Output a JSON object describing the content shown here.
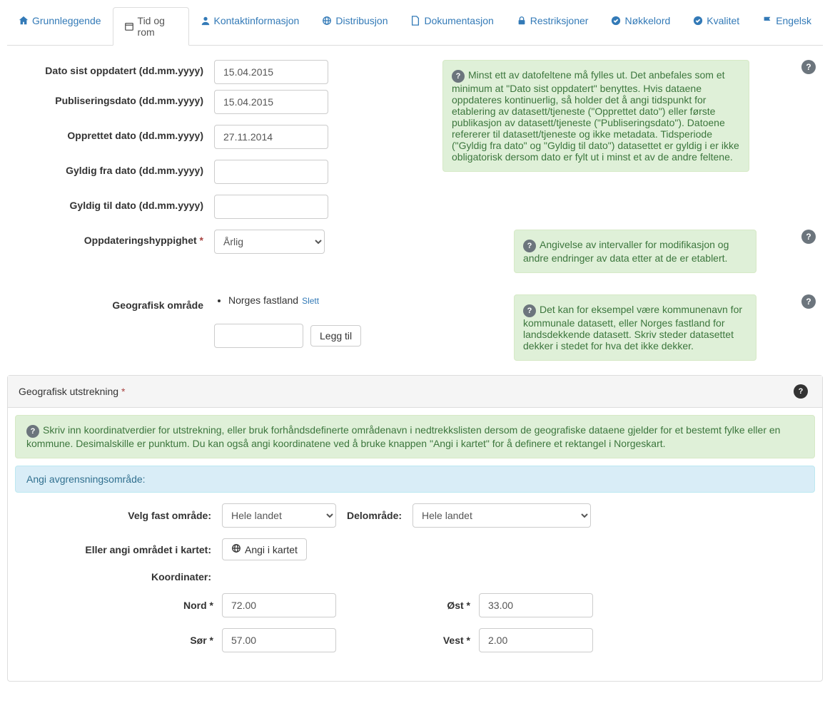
{
  "tabs": {
    "grunnleggende": "Grunnleggende",
    "tid_og_rom": "Tid og rom",
    "kontaktinformasjon": "Kontaktinformasjon",
    "distribusjon": "Distribusjon",
    "dokumentasjon": "Dokumentasjon",
    "restriksjoner": "Restriksjoner",
    "nokkelord": "Nøkkelord",
    "kvalitet": "Kvalitet",
    "engelsk": "Engelsk"
  },
  "labels": {
    "dato_sist_oppdatert": "Dato sist oppdatert (dd.mm.yyyy)",
    "publiseringsdato": "Publiseringsdato (dd.mm.yyyy)",
    "opprettet_dato": "Opprettet dato (dd.mm.yyyy)",
    "gyldig_fra": "Gyldig fra dato (dd.mm.yyyy)",
    "gyldig_til": "Gyldig til dato (dd.mm.yyyy)",
    "oppdateringshyppighet": "Oppdateringshyppighet",
    "geografisk_omrade": "Geografisk område",
    "legg_til": "Legg til",
    "slett": "Slett",
    "velg_fast_omrade": "Velg fast område:",
    "delomrade": "Delområde:",
    "eller_angi": "Eller angi området i kartet:",
    "angi_i_kartet": "Angi i kartet",
    "koordinater": "Koordinater:",
    "nord": "Nord",
    "sor": "Sør",
    "ost": "Øst",
    "vest": "Vest",
    "angi_avgrensning": "Angi avgrensningsområde:"
  },
  "values": {
    "dato_sist_oppdatert": "15.04.2015",
    "publiseringsdato": "15.04.2015",
    "opprettet_dato": "27.11.2014",
    "gyldig_fra": "",
    "gyldig_til": "",
    "oppdateringshyppighet": "Årlig",
    "geo_area_input": "",
    "velg_fast_omrade": "Hele landet",
    "delomrade": "Hele landet",
    "nord": "72.00",
    "sor": "57.00",
    "ost": "33.00",
    "vest": "2.00"
  },
  "geo_areas": [
    "Norges fastland"
  ],
  "help": {
    "dates": "Minst ett av datofeltene må fylles ut. Det anbefales som et minimum at \"Dato sist oppdatert\" benyttes. Hvis dataene oppdateres kontinuerlig, så holder det å angi tidspunkt for etablering av datasett/tjeneste (\"Opprettet dato\") eller første publikasjon av datasett/tjeneste (\"Publiseringsdato\"). Datoene refererer til datasett/tjeneste og ikke metadata. Tidsperiode (\"Gyldig fra dato\" og \"Gyldig til dato\") datasettet er gyldig i er ikke obligatorisk dersom dato er fylt ut i minst et av de andre feltene.",
    "frequency": "Angivelse av intervaller for modifikasjon og andre endringer av data etter at de er etablert.",
    "geo": "Det kan for eksempel være kommunenavn for kommunale datasett, eller Norges fastland for landsdekkende datasett. Skriv steder datasettet dekker i stedet for hva det ikke dekker.",
    "extent_title": "Geografisk utstrekning",
    "extent_body": "Skriv inn koordinatverdier for utstrekning, eller bruk forhåndsdefinerte områdenavn i nedtrekkslisten dersom de geografiske dataene gjelder for et bestemt fylke eller en kommune. Desimalskille er punktum. Du kan også angi koordinatene ved å bruke knappen \"Angi i kartet\" for å definere et rektangel i Norgeskart."
  }
}
